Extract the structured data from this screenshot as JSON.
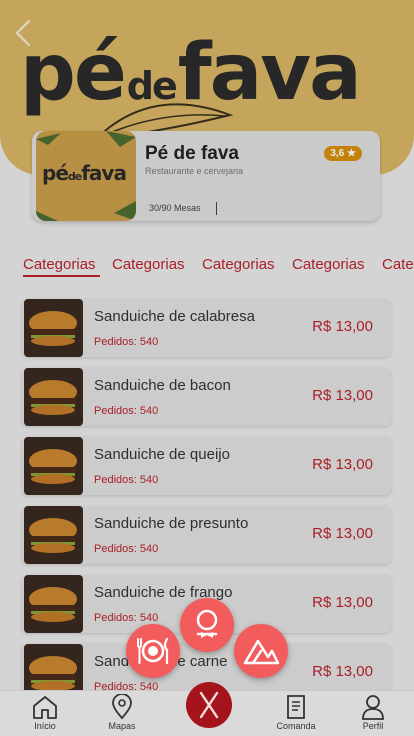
{
  "banner": {
    "logo_big_1": "pé",
    "logo_small": "de",
    "logo_big_2": "fava"
  },
  "restaurant": {
    "name": "Pé de fava",
    "subtitle": "Restaurante e cervejaria",
    "rating": "3,6 ★",
    "tables": "30/90 Mesas",
    "thumb_logo_1": "pé",
    "thumb_logo_small": "de",
    "thumb_logo_2": "fava"
  },
  "tabs": [
    "Categorias",
    "Categorias",
    "Categorias",
    "Categorias",
    "Cate"
  ],
  "products": [
    {
      "name": "Sanduiche de calabresa",
      "orders": "Pedidos: 540",
      "price": "R$ 13,00"
    },
    {
      "name": "Sanduiche de bacon",
      "orders": "Pedidos: 540",
      "price": "R$ 13,00"
    },
    {
      "name": "Sanduiche de queijo",
      "orders": "Pedidos: 540",
      "price": "R$ 13,00"
    },
    {
      "name": "Sanduiche de presunto",
      "orders": "Pedidos: 540",
      "price": "R$ 13,00"
    },
    {
      "name": "Sanduiche de frango",
      "orders": "Pedidos: 540",
      "price": "R$ 13,00"
    },
    {
      "name": "Sanduiche de carne",
      "orders": "Pedidos: 540",
      "price": "R$ 13,00"
    }
  ],
  "fab_menu": [
    "plate-cutlery-icon",
    "waiter-icon",
    "mountain-icon"
  ],
  "bottom_nav": {
    "home": "Início",
    "maps": "Mapas",
    "comanda": "Comanda",
    "profile": "Perfil"
  },
  "colors": {
    "accent": "#b8232c",
    "fab": "#f25c5c",
    "banner": "#d6b463",
    "rating": "#d68e0d"
  }
}
